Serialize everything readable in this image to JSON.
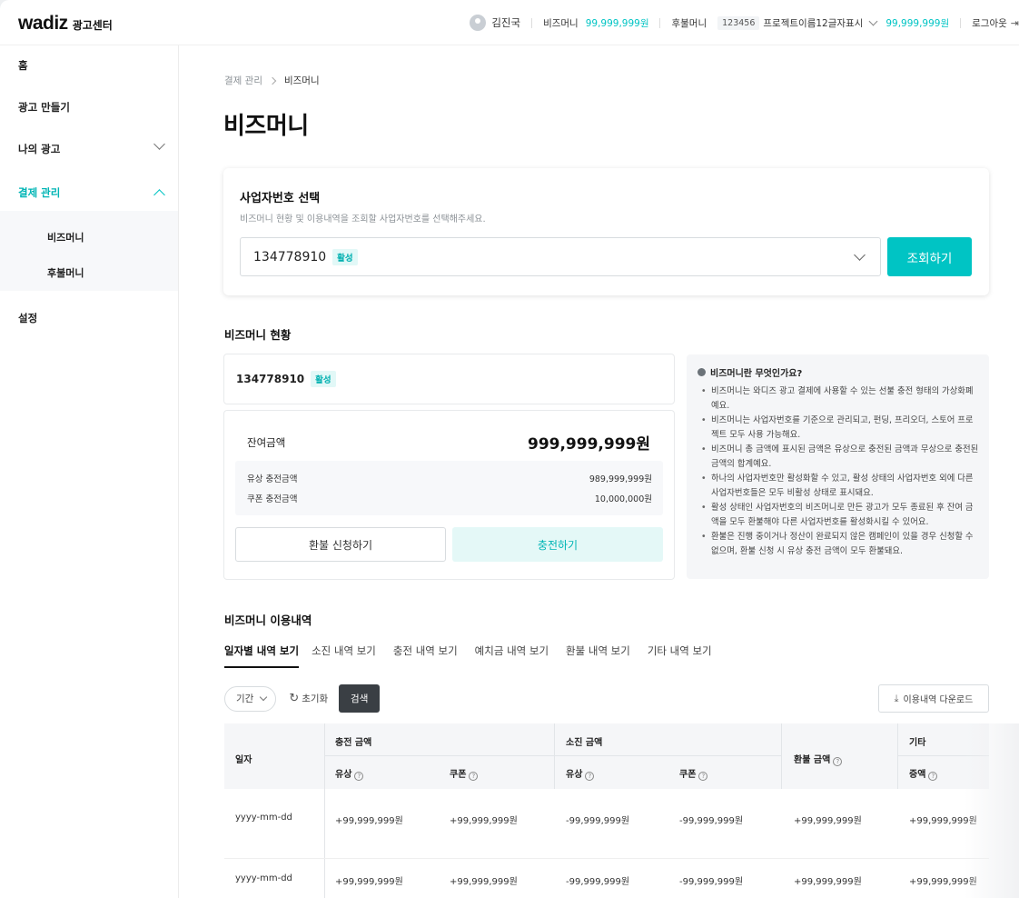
{
  "header": {
    "logo_word": "wadiz",
    "logo_sub": "광고센터",
    "user_name": "김진국",
    "bizmoney_label": "비즈머니",
    "bizmoney_value": "99,999,999원",
    "postpay_label": "후불머니",
    "project_id": "123456",
    "project_name": "프로젝트이름12글자표시",
    "postpay_value": "99,999,999원",
    "logout_label": "로그아웃"
  },
  "sidebar": {
    "items": [
      {
        "label": "홈"
      },
      {
        "label": "광고 만들기"
      },
      {
        "label": "나의 광고"
      },
      {
        "label": "결제 관리"
      },
      {
        "label": "설정"
      }
    ],
    "sub_items": [
      {
        "label": "비즈머니"
      },
      {
        "label": "후불머니"
      }
    ]
  },
  "breadcrumb": {
    "parent": "결제 관리",
    "current": "비즈머니"
  },
  "page_title": "비즈머니",
  "business_select": {
    "title": "사업자번호 선택",
    "description": "비즈머니 현황 및 이용내역을 조회할 사업자번호를 선택해주세요.",
    "selected_value": "134778910",
    "selected_badge": "활성",
    "query_button": "조회하기"
  },
  "status": {
    "section_title": "비즈머니 현황",
    "biz_number": "134778910",
    "badge": "활성",
    "balance_label": "잔여금액",
    "balance_value": "999,999,999원",
    "paid_label": "유상 충전금액",
    "paid_value": "989,999,999원",
    "coupon_label": "쿠폰 충전금액",
    "coupon_value": "10,000,000원",
    "refund_button": "환불 신청하기",
    "charge_button": "충전하기"
  },
  "info": {
    "title": "비즈머니란 무엇인가요?",
    "items": [
      "비즈머니는 와디즈 광고 결제에 사용할 수 있는 선불 충전 형태의 가상화폐예요.",
      "비즈머니는 사업자번호를 기준으로 관리되고, 펀딩, 프리오더, 스토어 프로젝트 모두 사용 가능해요.",
      "비즈머니 총 금액에 표시된 금액은 유상으로 충전된 금액과 무상으로 충전된 금액의 합계예요.",
      "하나의 사업자번호만 활성화할 수 있고, 활성 상태의 사업자번호 외에 다른 사업자번호들은 모두 비활성 상태로 표시돼요.",
      "활성 상태인 사업자번호의 비즈머니로 만든 광고가 모두 종료된 후 잔여 금액을 모두 환불해야 다른 사업자번호를 활성화시킬 수 있어요.",
      "환불은 진행 중이거나 정산이 완료되지 않은 캠페인이 있을 경우 신청할 수 없으며, 환불 신청 시 유상 충전 금액이 모두 환불돼요."
    ]
  },
  "usage": {
    "section_title": "비즈머니 이용내역",
    "tabs": [
      {
        "label": "일자별 내역 보기"
      },
      {
        "label": "소진 내역 보기"
      },
      {
        "label": "충전 내역 보기"
      },
      {
        "label": "예치금 내역 보기"
      },
      {
        "label": "환불 내역 보기"
      },
      {
        "label": "기타 내역 보기"
      }
    ],
    "period_label": "기간",
    "reset_label": "초기화",
    "search_label": "검색",
    "download_label": "이용내역 다운로드"
  },
  "table": {
    "col_date": "일자",
    "group_charge": "충전 금액",
    "group_spend": "소진 금액",
    "col_refund": "환불 금액",
    "group_etc": "기타",
    "sub_paid": "유상",
    "sub_coupon": "쿠폰",
    "sub_spend_paid": "유상",
    "sub_spend_coupon": "쿠폰",
    "sub_etc": "증액",
    "rows": [
      {
        "date": "yyyy-mm-dd",
        "charge_paid": "+99,999,999원",
        "charge_coupon": "+99,999,999원",
        "spend_paid": "-99,999,999원",
        "spend_coupon": "-99,999,999원",
        "refund": "+99,999,999원",
        "etc": "+99,999,999원"
      },
      {
        "date": "yyyy-mm-dd",
        "charge_paid": "+99,999,999원",
        "charge_coupon": "+99,999,999원",
        "spend_paid": "-99,999,999원",
        "spend_coupon": "-99,999,999원",
        "refund": "+99,999,999원",
        "etc": "+99,999,999원"
      }
    ]
  },
  "colors": {
    "accent": "#00c4c4",
    "dark_button": "#3a3f44"
  }
}
